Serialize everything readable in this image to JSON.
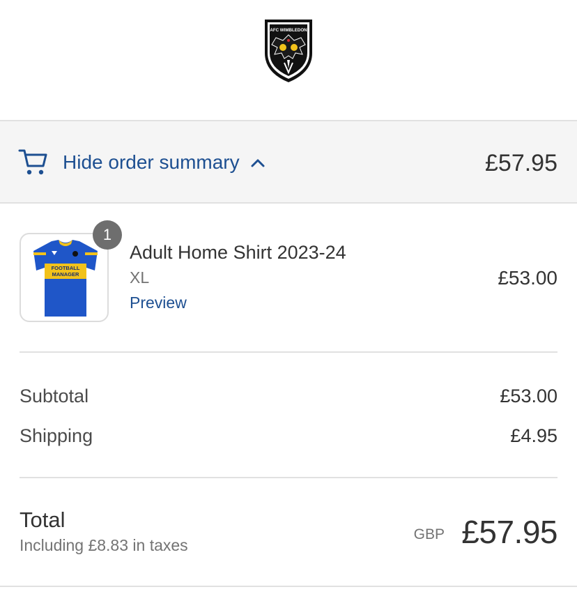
{
  "header": {
    "logo_icon": "afc-wimbledon-crest-icon",
    "logo_text": "AFC WIMBLEDON"
  },
  "summary_toggle": {
    "label": "Hide order summary",
    "icon": "cart-icon",
    "chevron": "chevron-up-icon",
    "total": "£57.95"
  },
  "line_item": {
    "quantity": "1",
    "name": "Adult Home Shirt 2023-24",
    "variant": "XL",
    "preview_label": "Preview",
    "price": "£53.00",
    "image": "football-shirt-image",
    "shirt_sponsor": "FOOTBALL MANAGER"
  },
  "costs": [
    {
      "label": "Subtotal",
      "value": "£53.00"
    },
    {
      "label": "Shipping",
      "value": "£4.95"
    }
  ],
  "total": {
    "label": "Total",
    "tax_note": "Including £8.83 in taxes",
    "currency": "GBP",
    "amount": "£57.95"
  },
  "colors": {
    "accent": "#1d4f91",
    "bar_background": "#f5f5f5",
    "divider": "#e1e1e1",
    "badge": "#6e6e6e",
    "shirt_blue": "#1f56c8",
    "shirt_yellow": "#f2c21b"
  }
}
